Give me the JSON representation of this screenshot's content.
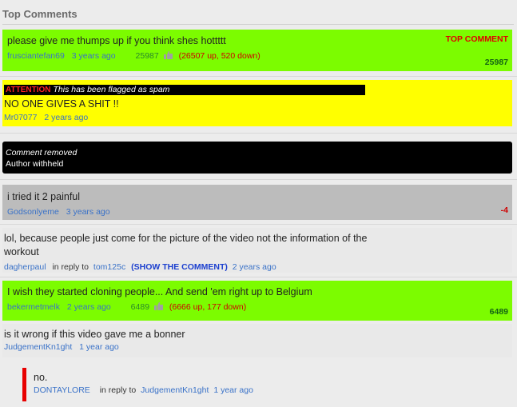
{
  "header": {
    "title": "Top Comments"
  },
  "icons": {
    "thumb": "thumbs-up-icon"
  },
  "colors": {
    "top_green": "#7cfc00",
    "spam_yellow": "#ffff00",
    "removed_black": "#000000",
    "low_gray": "#bcbcbc",
    "link_blue": "#3a72c8",
    "red": "#d00000"
  },
  "comments": [
    {
      "text": "please give me thumps up if you think shes hottttt",
      "user": "frusciantefan69",
      "time": "3 years ago",
      "score": "25987",
      "updown": "(26507 up, 520 down)",
      "label": "TOP COMMENT",
      "score_right": "25987"
    },
    {
      "attention": "ATTENTION",
      "flag": "This has been flagged as spam",
      "text": "NO ONE GIVES A SHIT !!",
      "user": "Mr07077",
      "time": "2 years ago"
    },
    {
      "removed": "Comment removed",
      "withheld": "Author withheld"
    },
    {
      "text": "i tried it 2 painful",
      "user": "Godsonlyeme",
      "time": "3 years ago",
      "score_right": "-4"
    },
    {
      "text": "lol, because people just come for the picture of the video not the information of the workout",
      "user": "dagherpaul",
      "reply_prefix": "in reply to",
      "reply_user": "tom125c",
      "show_comment": "(SHOW THE COMMENT)",
      "time": "2 years ago"
    },
    {
      "text": "I wish they started cloning people... And send 'em right up to Belgium",
      "user": "bekermetmelk",
      "time": "2 years ago",
      "score": "6489",
      "updown": "(6666 up, 177 down)",
      "score_right": "6489"
    },
    {
      "text": "is it wrong if this video gave me a bonner",
      "user": "JudgementKn1ght",
      "time": "1 year ago"
    },
    {
      "text": "no.",
      "user": "DONTAYLORE",
      "reply_prefix": "in reply to",
      "reply_user": "JudgementKn1ght",
      "time": "1 year ago"
    }
  ]
}
